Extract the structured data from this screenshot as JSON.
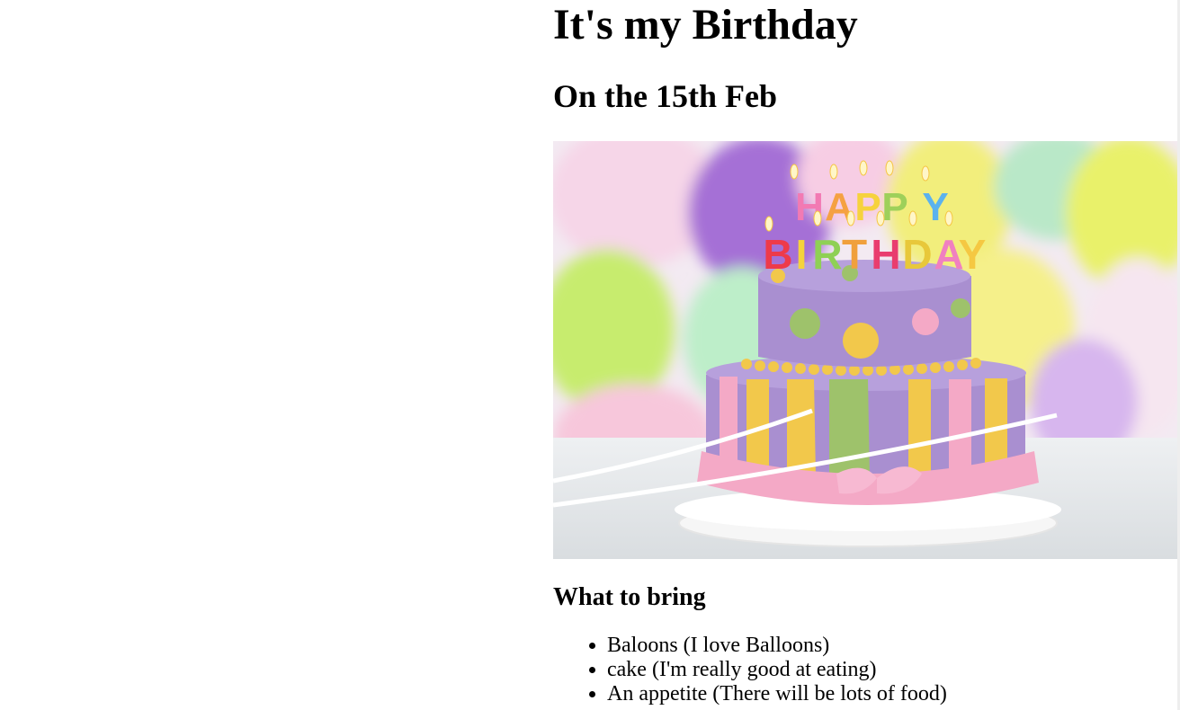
{
  "page": {
    "title": "It's my Birthday",
    "subtitle": "On the 15th Feb",
    "image": {
      "candle_letters_top": "HAPPY",
      "candle_letters_bottom": "BIRTHDAY"
    },
    "section_heading": "What to bring",
    "items": [
      "Baloons (I love Balloons)",
      "cake (I'm really good at eating)",
      "An appetite (There will be lots of food)"
    ]
  },
  "colors": {
    "cake_purple": "#a98fd0",
    "ribbon_pink": "#f4a9c6",
    "dot_green": "#9ec26b",
    "dot_yellow": "#f2c84b"
  }
}
